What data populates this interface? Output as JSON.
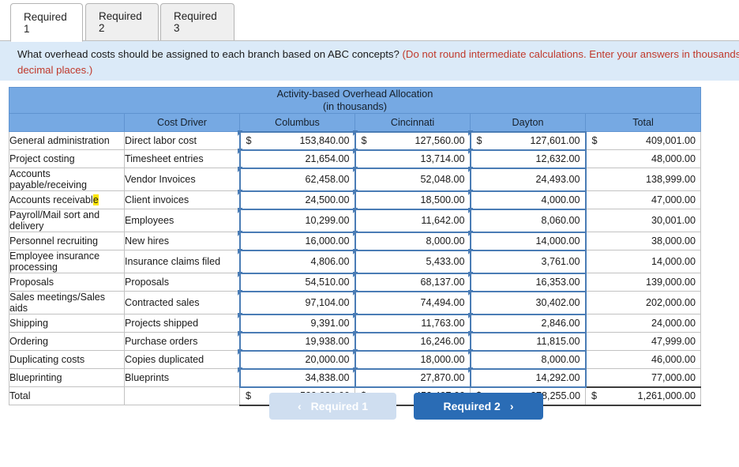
{
  "tabs": [
    {
      "label": "Required 1",
      "active": true
    },
    {
      "label": "Required 2",
      "active": false
    },
    {
      "label": "Required 3",
      "active": false
    }
  ],
  "banner": {
    "question": "What overhead costs should be assigned to each branch based on ABC concepts? ",
    "note": "(Do not round intermediate calculations. Enter your answers in thousands of dollars, rounded to two decimal places.)",
    "note_color": "#c0392b",
    "background": "#dbeaf8"
  },
  "table": {
    "title_line1": "Activity-based Overhead Allocation",
    "title_line2": "(in thousands)",
    "header_color": "#76a9e3",
    "columns": [
      "",
      "Cost Driver",
      "Columbus",
      "Cincinnati",
      "Dayton",
      "Total"
    ],
    "rows": [
      {
        "activity": "General administration",
        "driver": "Direct labor cost",
        "columbus": "153,840.00",
        "cincinnati": "127,560.00",
        "dayton": "127,601.00",
        "total": "409,001.00",
        "currency": true
      },
      {
        "activity": "Project costing",
        "driver": "Timesheet entries",
        "columbus": "21,654.00",
        "cincinnati": "13,714.00",
        "dayton": "12,632.00",
        "total": "48,000.00",
        "currency": false
      },
      {
        "activity": "Accounts payable/receiving",
        "driver": "Vendor Invoices",
        "columbus": "62,458.00",
        "cincinnati": "52,048.00",
        "dayton": "24,493.00",
        "total": "138,999.00",
        "currency": false
      },
      {
        "activity": "Accounts receivable",
        "activity_highlight": "e",
        "driver": "Client invoices",
        "columbus": "24,500.00",
        "cincinnati": "18,500.00",
        "dayton": "4,000.00",
        "total": "47,000.00",
        "currency": false
      },
      {
        "activity": "Payroll/Mail sort and delivery",
        "driver": "Employees",
        "columbus": "10,299.00",
        "cincinnati": "11,642.00",
        "dayton": "8,060.00",
        "total": "30,001.00",
        "currency": false
      },
      {
        "activity": "Personnel recruiting",
        "driver": "New hires",
        "columbus": "16,000.00",
        "cincinnati": "8,000.00",
        "dayton": "14,000.00",
        "total": "38,000.00",
        "currency": false
      },
      {
        "activity": "Employee insurance processing",
        "driver": "Insurance claims filed",
        "columbus": "4,806.00",
        "cincinnati": "5,433.00",
        "dayton": "3,761.00",
        "total": "14,000.00",
        "currency": false
      },
      {
        "activity": "Proposals",
        "driver": "Proposals",
        "columbus": "54,510.00",
        "cincinnati": "68,137.00",
        "dayton": "16,353.00",
        "total": "139,000.00",
        "currency": false
      },
      {
        "activity": "Sales meetings/Sales aids",
        "driver": "Contracted sales",
        "columbus": "97,104.00",
        "cincinnati": "74,494.00",
        "dayton": "30,402.00",
        "total": "202,000.00",
        "currency": false
      },
      {
        "activity": "Shipping",
        "driver": "Projects shipped",
        "columbus": "9,391.00",
        "cincinnati": "11,763.00",
        "dayton": "2,846.00",
        "total": "24,000.00",
        "currency": false
      },
      {
        "activity": "Ordering",
        "driver": "Purchase orders",
        "columbus": "19,938.00",
        "cincinnati": "16,246.00",
        "dayton": "11,815.00",
        "total": "47,999.00",
        "currency": false
      },
      {
        "activity": "Duplicating costs",
        "driver": "Copies duplicated",
        "columbus": "20,000.00",
        "cincinnati": "18,000.00",
        "dayton": "8,000.00",
        "total": "46,000.00",
        "currency": false
      },
      {
        "activity": "Blueprinting",
        "driver": "Blueprints",
        "columbus": "34,838.00",
        "cincinnati": "27,870.00",
        "dayton": "14,292.00",
        "total": "77,000.00",
        "currency": false
      }
    ],
    "total_row": {
      "activity": "Total",
      "driver": "",
      "columbus": "529,338.00",
      "cincinnati": "453,407.00",
      "dayton": "278,255.00",
      "total": "1,261,000.00",
      "currency": true
    },
    "currency_symbol": "$"
  },
  "nav": {
    "prev_label": "Required 1",
    "prev_icon": "chevron-left-icon",
    "prev_glyph": "‹",
    "prev_color": "#cfdef0",
    "next_label": "Required 2",
    "next_icon": "chevron-right-icon",
    "next_glyph": "›",
    "next_color": "#2a6cb5"
  }
}
